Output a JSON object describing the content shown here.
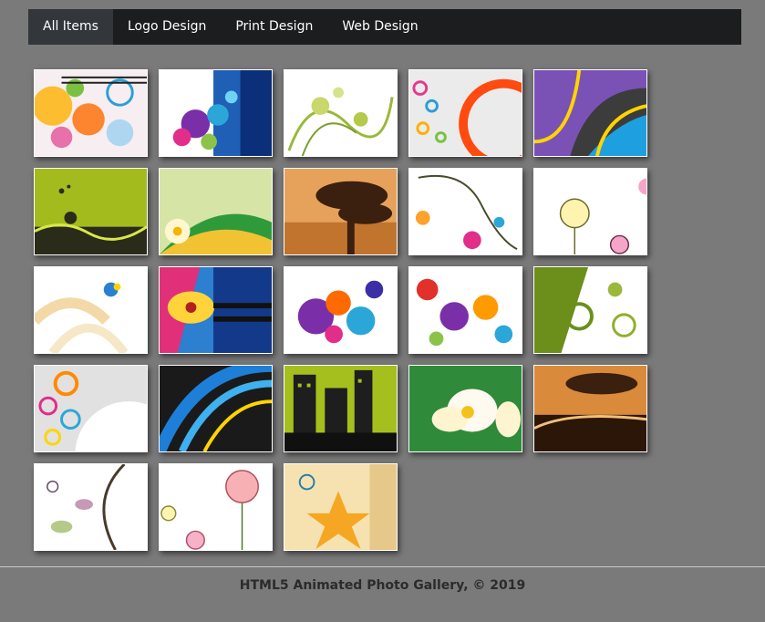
{
  "nav": {
    "items": [
      {
        "label": "All Items",
        "active": true
      },
      {
        "label": "Logo Design",
        "active": false
      },
      {
        "label": "Print Design",
        "active": false
      },
      {
        "label": "Web Design",
        "active": false
      }
    ]
  },
  "gallery": {
    "items": [
      {
        "theme": "floral-orange-circles"
      },
      {
        "theme": "blue-purple-swirls"
      },
      {
        "theme": "green-vines"
      },
      {
        "theme": "red-orange-ring"
      },
      {
        "theme": "purple-blue-rays"
      },
      {
        "theme": "olive-grass"
      },
      {
        "theme": "green-waves-flower"
      },
      {
        "theme": "bonsai-tree"
      },
      {
        "theme": "white-flowers-vine"
      },
      {
        "theme": "yellow-rose-sketch"
      },
      {
        "theme": "butterfly-splash"
      },
      {
        "theme": "tropical-flower-stripes"
      },
      {
        "theme": "colorful-paisley"
      },
      {
        "theme": "colorful-drops"
      },
      {
        "theme": "green-gears"
      },
      {
        "theme": "circle-rings"
      },
      {
        "theme": "blue-arcs"
      },
      {
        "theme": "city-silhouette"
      },
      {
        "theme": "plumeria"
      },
      {
        "theme": "grunge-tree"
      },
      {
        "theme": "leaf-vine-sketch"
      },
      {
        "theme": "pink-roses"
      },
      {
        "theme": "yellow-star-flower"
      }
    ]
  },
  "footer": {
    "text": "HTML5 Animated Photo Gallery, © 2019"
  }
}
